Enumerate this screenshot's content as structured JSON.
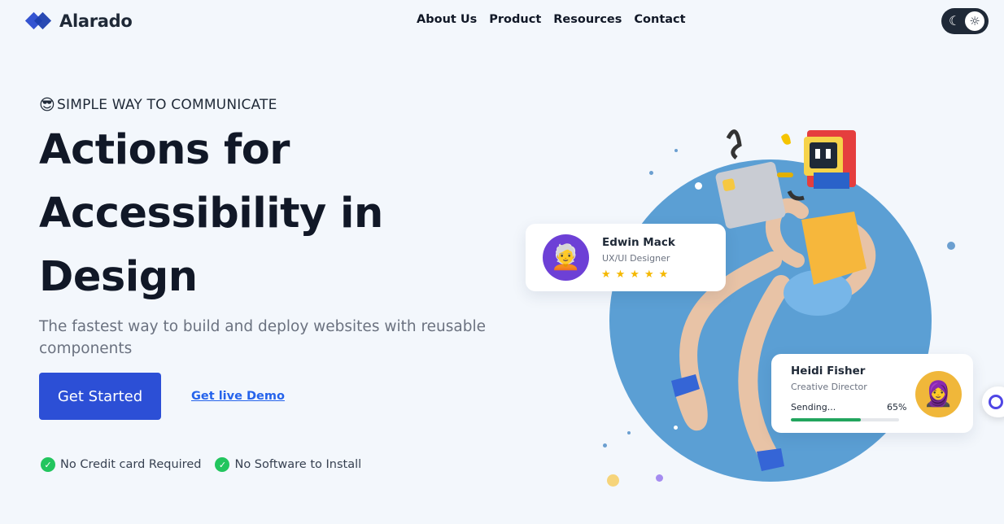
{
  "header": {
    "logo_text": "Alarado",
    "nav": [
      "About Us",
      "Product",
      "Resources",
      "Contact"
    ],
    "theme_toggle": {
      "moon_icon": "☾",
      "sun_icon": "☼"
    }
  },
  "hero": {
    "tagline_emoji": "😎",
    "tagline": "SIMPLE WAY TO COMMUNICATE",
    "title_line1": "Actions for",
    "title_line2": "Accessibility in",
    "title_line3": "Design",
    "subtitle": "The fastest way to build and deploy websites with reusable components",
    "primary_button": "Get Started",
    "secondary_link": "Get live Demo",
    "features": [
      "No Credit card Required",
      "No Software to Install"
    ]
  },
  "cards": {
    "edwin": {
      "name": "Edwin Mack",
      "role": "UX/UI Designer",
      "avatar": "🧑‍🦳",
      "stars": "★★★★★",
      "rating": 5
    },
    "heidi": {
      "name": "Heidi Fisher",
      "role": "Creative Director",
      "avatar": "🧕",
      "sending_label": "Sending...",
      "progress_label": "65%",
      "progress": 0.65
    }
  },
  "colors": {
    "background": "#f3f7fc",
    "primary": "#2c4fd6",
    "circle": "#5b9fd4",
    "success": "#22c55e"
  }
}
